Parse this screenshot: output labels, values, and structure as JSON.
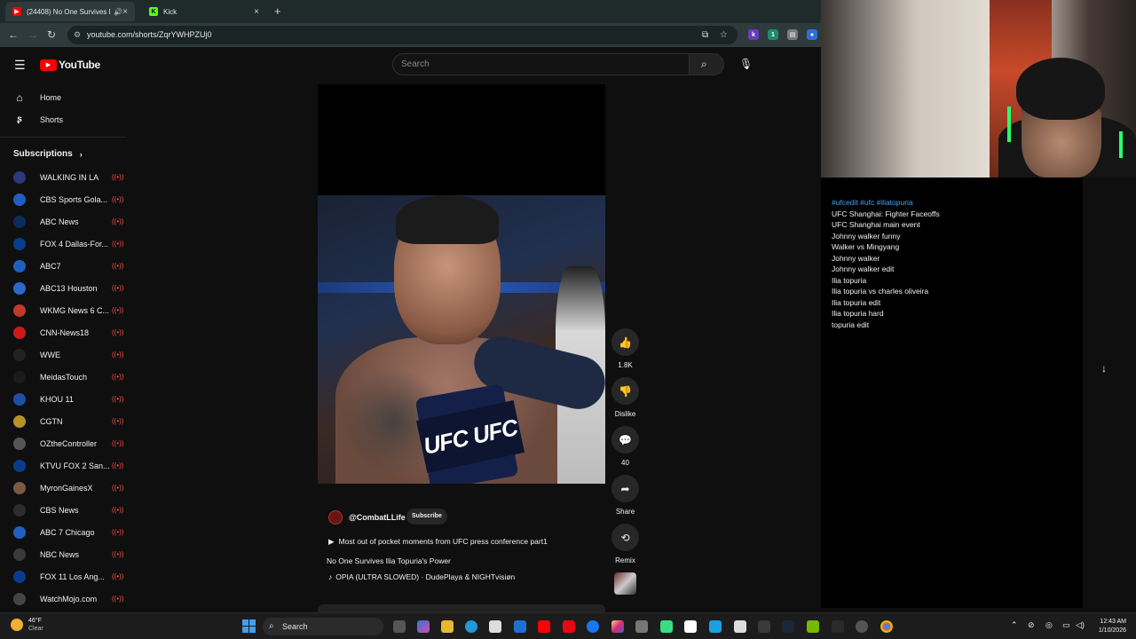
{
  "browser": {
    "tabs": [
      {
        "title": "(24408) No One Survives Ili...",
        "active": true
      },
      {
        "title": "Kick",
        "active": false
      }
    ],
    "url": "youtube.com/shorts/ZqrYWHPZUj0"
  },
  "header": {
    "logo_text": "YouTube",
    "search_placeholder": "Search"
  },
  "sidebar": {
    "items": [
      {
        "label": "Home",
        "icon": "home-icon"
      },
      {
        "label": "Shorts",
        "icon": "shorts-icon"
      }
    ],
    "subscriptions_label": "Subscriptions",
    "subscriptions": [
      {
        "label": "WALKING IN LA",
        "color": "#2a3a7a"
      },
      {
        "label": "CBS Sports Gola...",
        "color": "#1f5fbf"
      },
      {
        "label": "ABC News",
        "color": "#0d2c5c"
      },
      {
        "label": "FOX 4 Dallas-For...",
        "color": "#0b3b8c"
      },
      {
        "label": "ABC7",
        "color": "#1f5fbf"
      },
      {
        "label": "ABC13 Houston",
        "color": "#2c68c8"
      },
      {
        "label": "WKMG News 6 C...",
        "color": "#c0392b"
      },
      {
        "label": "CNN-News18",
        "color": "#cc1a1a"
      },
      {
        "label": "WWE",
        "color": "#222222"
      },
      {
        "label": "MeidasTouch",
        "color": "#1b1b1b"
      },
      {
        "label": "KHOU 11",
        "color": "#1f4fa8"
      },
      {
        "label": "CGTN",
        "color": "#b8922a"
      },
      {
        "label": "OZtheController",
        "color": "#555555"
      },
      {
        "label": "KTVU FOX 2 San...",
        "color": "#0b3b8c"
      },
      {
        "label": "MyronGainesX",
        "color": "#7a5a44"
      },
      {
        "label": "CBS News",
        "color": "#2d2d2d"
      },
      {
        "label": "ABC 7 Chicago",
        "color": "#1f5fbf"
      },
      {
        "label": "NBC News",
        "color": "#3a3a3a"
      },
      {
        "label": "FOX 11 Los Ang...",
        "color": "#0b3b8c"
      },
      {
        "label": "WatchMojo.com",
        "color": "#444444"
      }
    ],
    "live_glyph": "((•))"
  },
  "video": {
    "mic_text": "UFC UFC",
    "channel_handle": "@CombatLLife",
    "subscribe_label": "Subscribe",
    "description": "Most out of pocket moments from UFC press conference part1",
    "title_line": "No One Survives Ilia Topuria's Power",
    "music": "OPIA (ULTRA SLOWED) · DudePlaya & NIGHTvisiøn"
  },
  "actions": {
    "like_count": "1.8K",
    "dislike_label": "Dislike",
    "comment_count": "40",
    "share_label": "Share",
    "remix_label": "Remix"
  },
  "right_panel": {
    "hashtags": "#ufcedit #ufc #iliatopuria",
    "tags": [
      "UFC Shanghai: Fighter Faceoffs",
      "UFC Shanghai main event",
      "Johnny walker funny",
      "Walker vs Mingyang",
      "Johnny walker",
      "Johnny walker edit",
      "Ilia topuria",
      "Ilia topuria vs charles oliveira",
      "Ilia topuria edit",
      "Ilia topuria hard",
      "topuria edit"
    ]
  },
  "taskbar": {
    "weather_temp": "46°F",
    "weather_desc": "Clear",
    "search_label": "Search",
    "time": "12:43 AM",
    "date": "1/10/2026"
  },
  "colors": {
    "youtube_red": "#ff0000",
    "accent_blue": "#3ea6ff",
    "live_red": "#ff4e45"
  }
}
